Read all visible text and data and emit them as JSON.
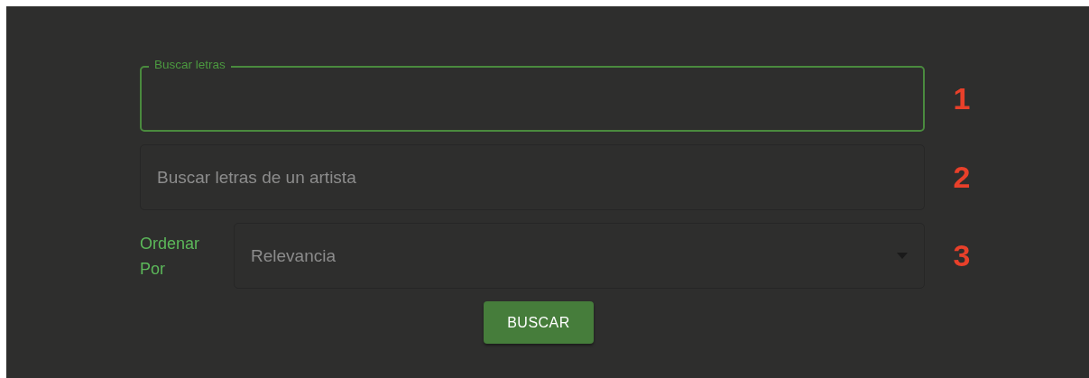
{
  "search_fields": [
    {
      "kind": "text",
      "label": "Buscar letras",
      "focused": true,
      "marker": "1"
    },
    {
      "kind": "text",
      "placeholder": "Buscar letras de un artista",
      "focused": false,
      "marker": "2"
    },
    {
      "kind": "select",
      "side_label": "Ordenar Por",
      "value": "Relevancia",
      "focused": false,
      "marker": "3"
    }
  ],
  "submit_button": {
    "label": "BUSCAR"
  }
}
